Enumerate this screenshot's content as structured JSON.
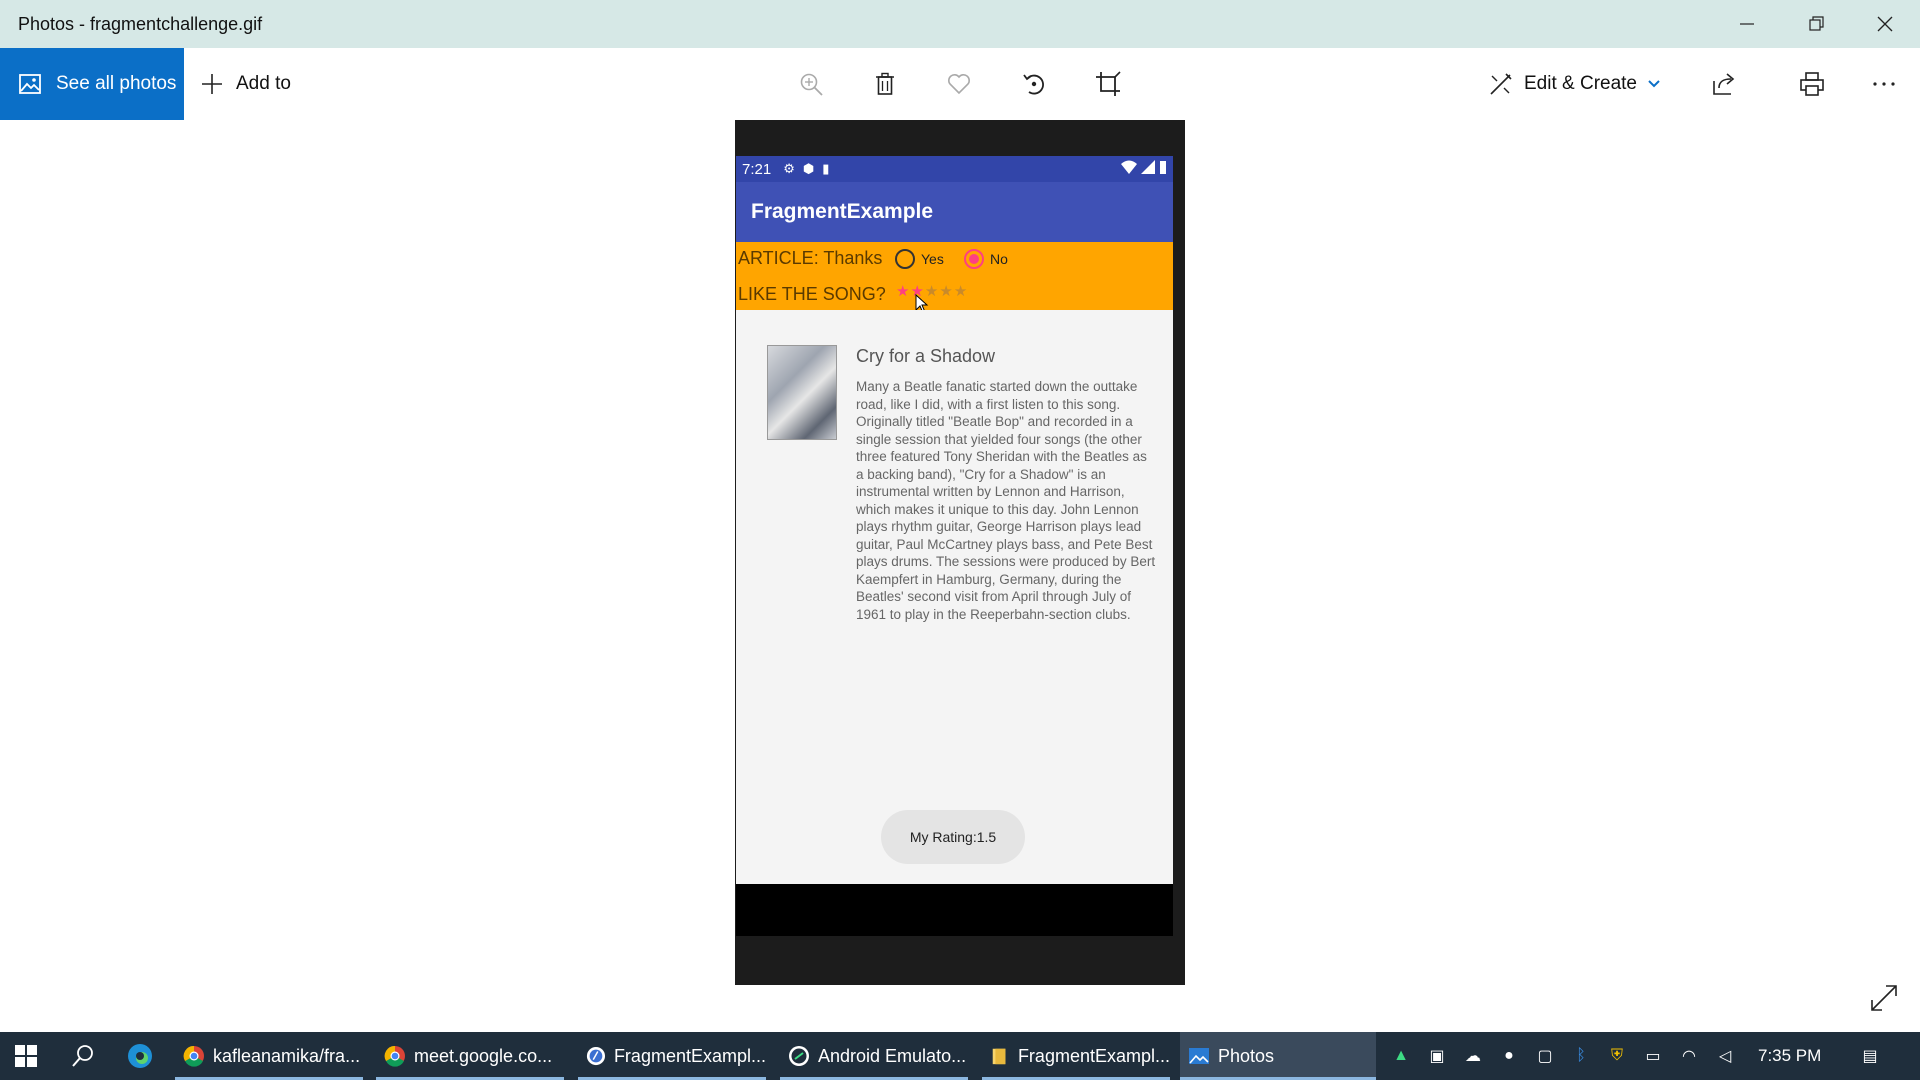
{
  "window": {
    "title": "Photos - fragmentchallenge.gif"
  },
  "toolbar": {
    "see_all_photos": "See all photos",
    "add_to": "Add to",
    "edit_create": "Edit & Create"
  },
  "phone": {
    "status_time": "7:21",
    "app_title": "FragmentExample",
    "article_label": "ARTICLE: Thanks",
    "radio_yes": "Yes",
    "radio_no": "No",
    "radio_selected": "No",
    "like_label": "LIKE THE SONG?",
    "stars_total": 5,
    "stars_rating": 1.5,
    "song_title": "Cry for a Shadow",
    "song_text": "Many a Beatle fanatic started down the outtake road, like I did, with a first listen to this song. Originally titled \"Beatle Bop\" and recorded in a single session that yielded four songs (the other three featured Tony Sheridan with the Beatles as a backing band), \"Cry for a Shadow\" is an instrumental written by Lennon and Harrison, which makes it unique to this day. John Lennon plays rhythm guitar, George Harrison plays lead guitar, Paul McCartney plays bass, and Pete Best plays drums. The sessions were produced by Bert Kaempfert in Hamburg, Germany, during the Beatles' second visit from April through July of 1961 to play in the Reeperbahn-section clubs.",
    "rating_chip": "My Rating:1.5"
  },
  "taskbar": {
    "items": [
      {
        "label": "kafleanamika/fra..."
      },
      {
        "label": "meet.google.co..."
      },
      {
        "label": "FragmentExampl..."
      },
      {
        "label": "Android Emulato..."
      },
      {
        "label": "FragmentExampl..."
      },
      {
        "label": "Photos"
      }
    ],
    "clock": "7:35 PM"
  },
  "colors": {
    "accent": "#0b6fc7",
    "app_bar": "#3f51b5",
    "orange_panel": "#ffa500",
    "pink": "#ff4081",
    "taskbar": "#1f2e3c"
  }
}
